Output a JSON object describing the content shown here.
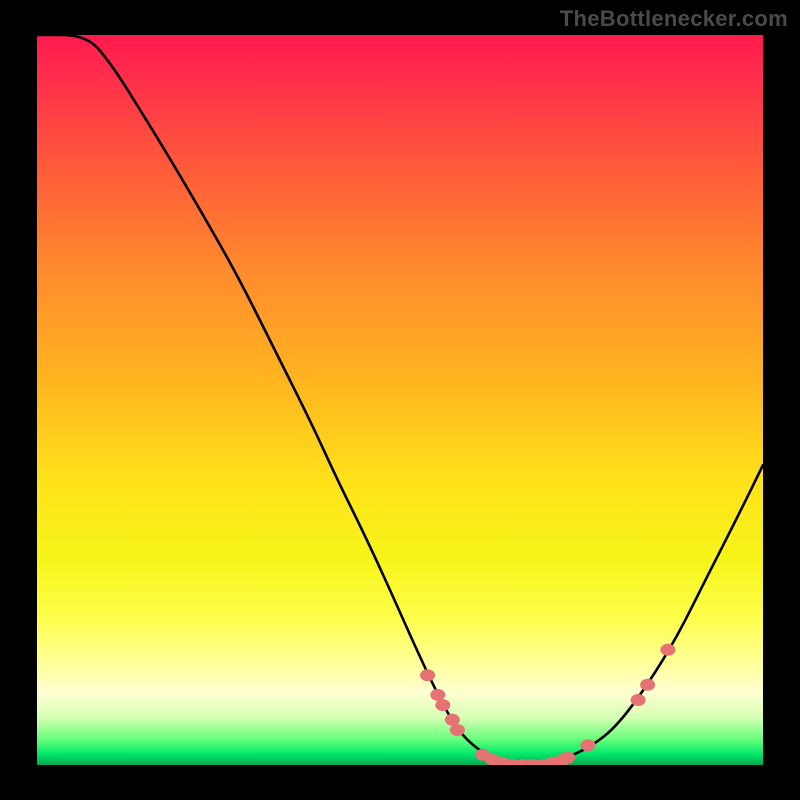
{
  "watermark": {
    "text": "TheBottlenecker.com"
  },
  "colors": {
    "frame_bg": "#000000",
    "gradient_stops": [
      {
        "offset": 0.0,
        "color": "#ff1a4d"
      },
      {
        "offset": 0.05,
        "color": "#ff2b4d"
      },
      {
        "offset": 0.18,
        "color": "#ff5a3a"
      },
      {
        "offset": 0.32,
        "color": "#ff8a2d"
      },
      {
        "offset": 0.48,
        "color": "#ffb71f"
      },
      {
        "offset": 0.62,
        "color": "#ffe41a"
      },
      {
        "offset": 0.72,
        "color": "#f6f51a"
      },
      {
        "offset": 0.8,
        "color": "#ffff4d"
      },
      {
        "offset": 0.86,
        "color": "#ffff99"
      },
      {
        "offset": 0.9,
        "color": "#ffffd2"
      },
      {
        "offset": 0.935,
        "color": "#d6ffb3"
      },
      {
        "offset": 0.965,
        "color": "#66ff7a"
      },
      {
        "offset": 0.985,
        "color": "#00e86b"
      },
      {
        "offset": 1.0,
        "color": "#00a84f"
      }
    ],
    "curve_stroke": "#000000",
    "dot_fill": "#e57373"
  },
  "chart_data": {
    "type": "line",
    "title": "",
    "xlabel": "",
    "ylabel": "",
    "xlim": [
      0,
      100
    ],
    "ylim": [
      0,
      100
    ],
    "grid": false,
    "legend": null,
    "curve": [
      {
        "x": 0.0,
        "y": 100.0
      },
      {
        "x": 6.9,
        "y": 100.0
      },
      {
        "x": 10.3,
        "y": 95.9
      },
      {
        "x": 13.8,
        "y": 90.4
      },
      {
        "x": 17.2,
        "y": 84.9
      },
      {
        "x": 22.1,
        "y": 76.7
      },
      {
        "x": 27.6,
        "y": 67.1
      },
      {
        "x": 33.1,
        "y": 56.2
      },
      {
        "x": 37.9,
        "y": 46.6
      },
      {
        "x": 41.4,
        "y": 39.0
      },
      {
        "x": 44.8,
        "y": 32.2
      },
      {
        "x": 48.3,
        "y": 24.7
      },
      {
        "x": 51.7,
        "y": 17.1
      },
      {
        "x": 55.2,
        "y": 9.6
      },
      {
        "x": 57.9,
        "y": 4.8
      },
      {
        "x": 60.7,
        "y": 2.1
      },
      {
        "x": 63.4,
        "y": 0.7
      },
      {
        "x": 68.3,
        "y": 0.0
      },
      {
        "x": 72.4,
        "y": 0.7
      },
      {
        "x": 76.6,
        "y": 2.7
      },
      {
        "x": 80.0,
        "y": 5.5
      },
      {
        "x": 84.1,
        "y": 11.0
      },
      {
        "x": 88.3,
        "y": 17.8
      },
      {
        "x": 92.4,
        "y": 26.0
      },
      {
        "x": 96.6,
        "y": 34.2
      },
      {
        "x": 100.0,
        "y": 41.1
      }
    ],
    "highlight_points": [
      {
        "x": 53.8,
        "y": 12.3
      },
      {
        "x": 55.2,
        "y": 9.6
      },
      {
        "x": 55.9,
        "y": 8.2
      },
      {
        "x": 57.2,
        "y": 6.2
      },
      {
        "x": 57.9,
        "y": 4.8
      },
      {
        "x": 61.4,
        "y": 1.4
      },
      {
        "x": 62.8,
        "y": 0.7
      },
      {
        "x": 64.1,
        "y": 0.3
      },
      {
        "x": 65.5,
        "y": 0.0
      },
      {
        "x": 66.9,
        "y": 0.0
      },
      {
        "x": 68.3,
        "y": 0.0
      },
      {
        "x": 69.7,
        "y": 0.0
      },
      {
        "x": 71.0,
        "y": 0.3
      },
      {
        "x": 72.4,
        "y": 0.7
      },
      {
        "x": 73.1,
        "y": 1.0
      },
      {
        "x": 75.9,
        "y": 2.7
      },
      {
        "x": 82.8,
        "y": 8.9
      },
      {
        "x": 84.1,
        "y": 11.0
      },
      {
        "x": 86.9,
        "y": 15.8
      }
    ]
  }
}
